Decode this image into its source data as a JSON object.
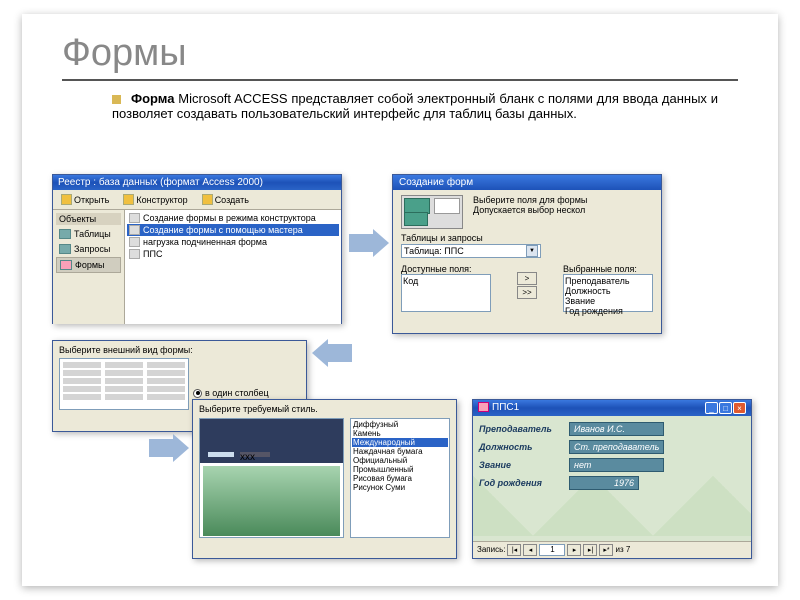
{
  "slide": {
    "title": "Формы",
    "body_bold": "Форма",
    "body_text": " Microsoft ACCESS представляет собой электронный бланк с полями для ввода данных и позволяет создавать пользовательский интерфейс для таблиц базы данных."
  },
  "db_window": {
    "title": "Реестр : база данных (формат Access 2000)",
    "toolbar": {
      "open": "Открыть",
      "design": "Конструктор",
      "create": "Создать"
    },
    "side_header": "Объекты",
    "side_items": [
      "Таблицы",
      "Запросы",
      "Формы"
    ],
    "list": [
      {
        "label": "Создание формы в режима конструктора",
        "sel": false
      },
      {
        "label": "Создание формы с помощью мастера",
        "sel": true
      },
      {
        "label": "нагрузка подчиненная форма",
        "sel": false
      },
      {
        "label": "ППС",
        "sel": false
      }
    ]
  },
  "wizard": {
    "title": "Создание форм",
    "hint1": "Выберите поля для формы",
    "hint2": "Допускается выбор нескол",
    "tables_label": "Таблицы и запросы",
    "table_value": "Таблица: ППС",
    "avail_label": "Доступные поля:",
    "avail_value": "Код",
    "chosen_label": "Выбранные поля:",
    "chosen": [
      "Преподаватель",
      "Должность",
      "Звание",
      "Год рождения"
    ],
    "buttons": [
      ">",
      ">>"
    ]
  },
  "appearance": {
    "title": "Выберите внешний вид формы:",
    "radio": "в один столбец"
  },
  "style": {
    "title": "Выберите требуемый стиль.",
    "preview_label": "xxx",
    "list": [
      "Диффузный",
      "Камень",
      "Международный",
      "Наждачная бумага",
      "Официальный",
      "Промышленный",
      "Рисовая бумага",
      "Рисунок Суми"
    ],
    "selected": "Международный"
  },
  "form": {
    "title": "ППС1",
    "fields": [
      {
        "label": "Преподаватель",
        "value": "Иванов И.С."
      },
      {
        "label": "Должность",
        "value": "Ст. преподаватель"
      },
      {
        "label": "Звание",
        "value": "нет"
      },
      {
        "label": "Год рождения",
        "value": "1976"
      }
    ],
    "nav": {
      "label": "Запись:",
      "current": "1",
      "total": "из 7"
    }
  }
}
